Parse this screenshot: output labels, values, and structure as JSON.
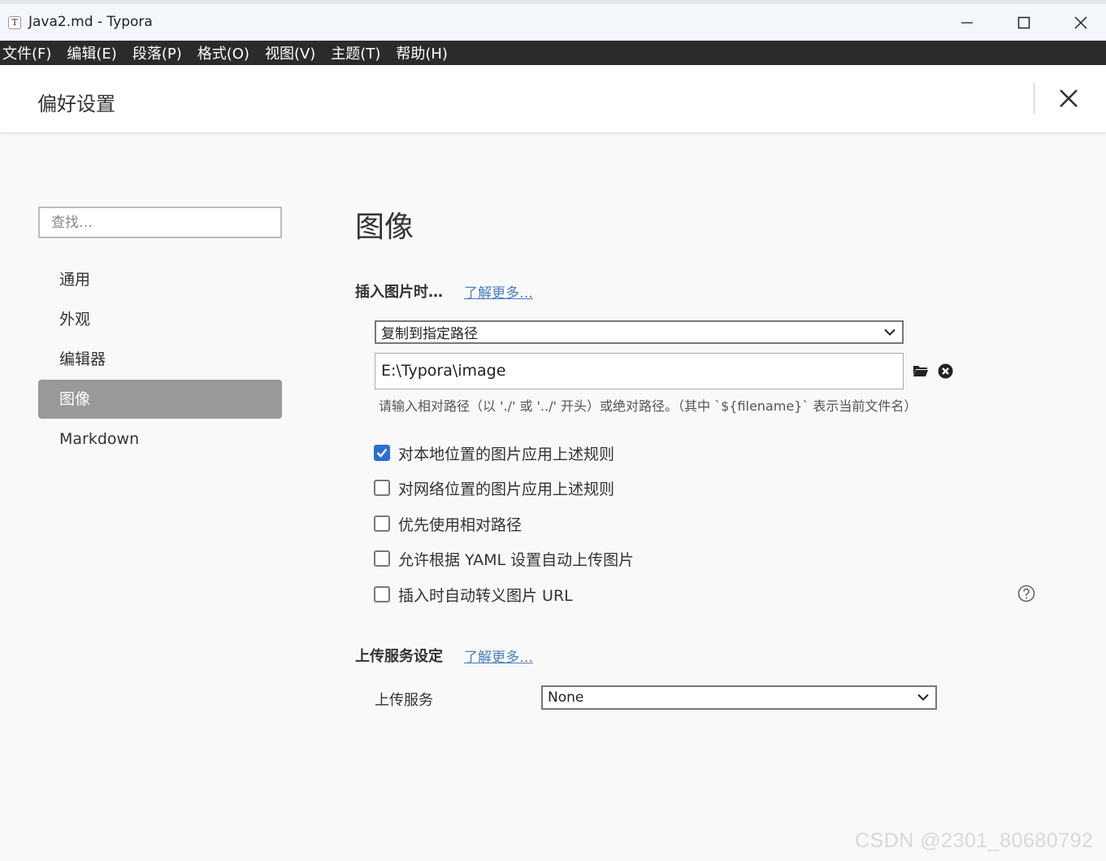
{
  "window": {
    "app_icon": "T",
    "title": "Java2.md - Typora",
    "controls": [
      "minimize-icon",
      "maximize-icon",
      "close-icon"
    ]
  },
  "menu": {
    "items": [
      "文件(F)",
      "编辑(E)",
      "段落(P)",
      "格式(O)",
      "视图(V)",
      "主题(T)",
      "帮助(H)"
    ]
  },
  "preferences": {
    "title": "偏好设置"
  },
  "sidebar": {
    "search_placeholder": "查找…",
    "items": [
      {
        "label": "通用",
        "active": false
      },
      {
        "label": "外观",
        "active": false
      },
      {
        "label": "编辑器",
        "active": false
      },
      {
        "label": "图像",
        "active": true
      },
      {
        "label": "Markdown",
        "active": false
      }
    ]
  },
  "main": {
    "section_title": "图像",
    "insert": {
      "heading": "插入图片时…",
      "learn_more": "了解更多…",
      "action_select": "复制到指定路径",
      "path_value": "E:\\Typora\\image",
      "hint": "请输入相对路径（以 './' 或 '../' 开头）或绝对路径。（其中 `${filename}` 表示当前文件名）"
    },
    "options": [
      {
        "label": "对本地位置的图片应用上述规则",
        "checked": true
      },
      {
        "label": "对网络位置的图片应用上述规则",
        "checked": false
      },
      {
        "label": "优先使用相对路径",
        "checked": false
      },
      {
        "label": "允许根据 YAML 设置自动上传图片",
        "checked": false
      },
      {
        "label": "插入时自动转义图片 URL",
        "checked": false
      }
    ],
    "upload": {
      "heading": "上传服务设定",
      "learn_more": "了解更多…",
      "service_label": "上传服务",
      "service_value": "None"
    }
  },
  "watermark": "CSDN @2301_80680792",
  "colors": {
    "accent": "#2c6fd1",
    "link": "#4a7fc0",
    "active_nav": "#999999",
    "menubar": "#2b2b2b"
  }
}
